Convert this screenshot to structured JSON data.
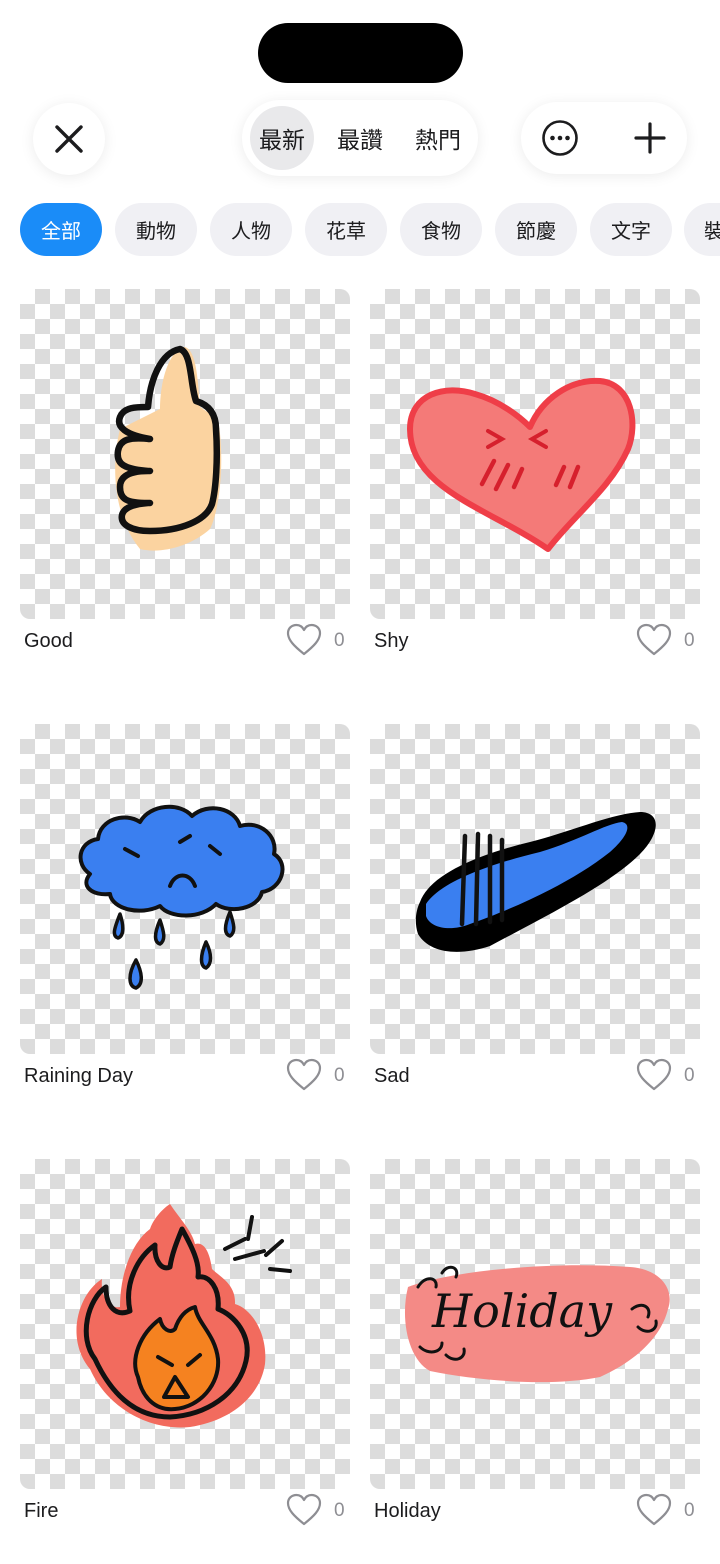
{
  "header": {
    "tabs": [
      {
        "label": "最新",
        "active": true
      },
      {
        "label": "最讚",
        "active": false
      },
      {
        "label": "熱門",
        "active": false
      }
    ],
    "close_icon": "close-icon",
    "more_icon": "ellipsis-circle-icon",
    "add_icon": "plus-icon"
  },
  "categories": [
    {
      "label": "全部",
      "active": true
    },
    {
      "label": "動物",
      "active": false
    },
    {
      "label": "人物",
      "active": false
    },
    {
      "label": "花草",
      "active": false
    },
    {
      "label": "食物",
      "active": false
    },
    {
      "label": "節慶",
      "active": false
    },
    {
      "label": "文字",
      "active": false
    },
    {
      "label": "裝",
      "active": false
    }
  ],
  "stickers": [
    {
      "title": "Good",
      "likes": "0",
      "icon": "thumbs-up-sticker"
    },
    {
      "title": "Shy",
      "likes": "0",
      "icon": "heart-sticker"
    },
    {
      "title": "Raining Day",
      "likes": "0",
      "icon": "rain-cloud-sticker"
    },
    {
      "title": "Sad",
      "likes": "0",
      "icon": "sad-blob-sticker"
    },
    {
      "title": "Fire",
      "likes": "0",
      "icon": "fire-sticker"
    },
    {
      "title": "Holiday",
      "likes": "0",
      "icon": "holiday-text-sticker",
      "art_text": "Holiday"
    }
  ],
  "colors": {
    "accent": "#1a8cf8",
    "chip_bg": "#f0f0f4",
    "muted": "#8e8e93"
  }
}
